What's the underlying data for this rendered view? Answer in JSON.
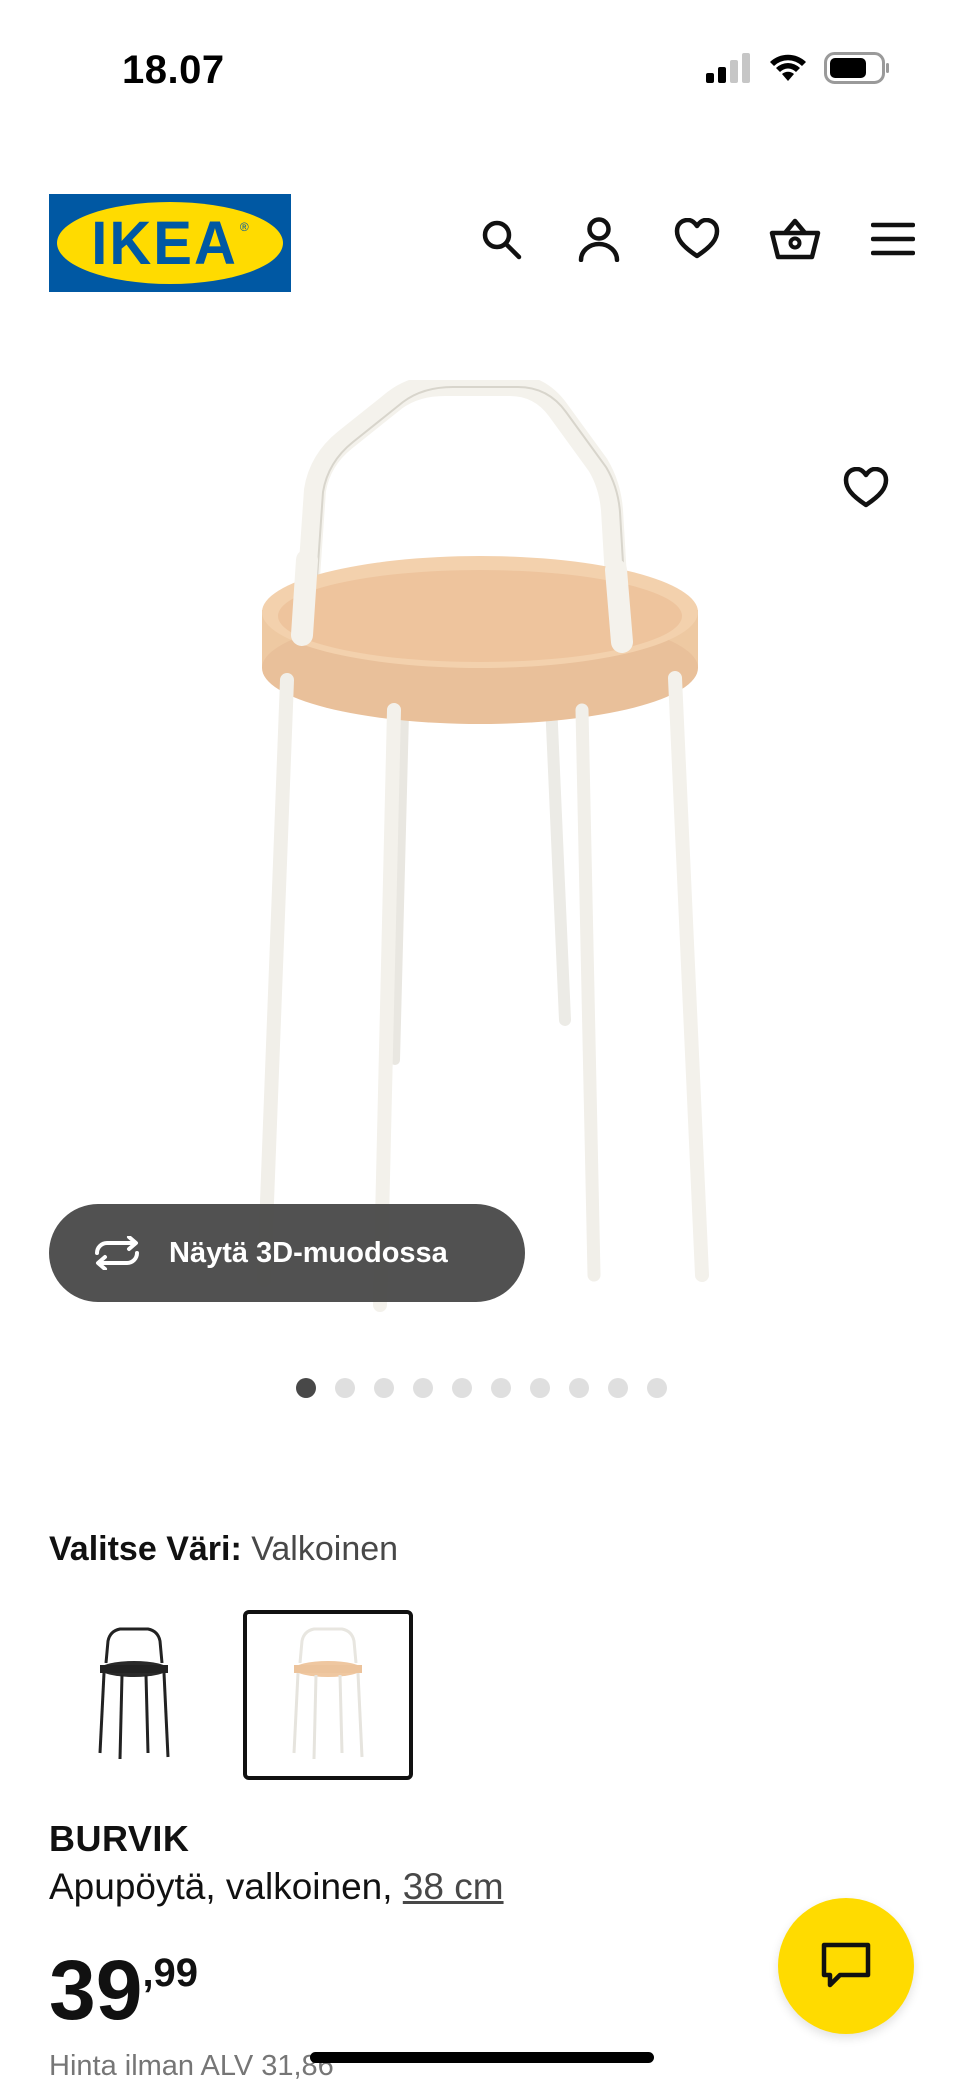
{
  "status_bar": {
    "time": "18.07",
    "icons": [
      "cellular-signal-icon",
      "wifi-icon",
      "battery-icon"
    ]
  },
  "header": {
    "logo_text": "IKEA",
    "nav_icons": [
      "search-icon",
      "user-icon",
      "heart-icon",
      "basket-icon",
      "menu-icon"
    ]
  },
  "gallery": {
    "view_3d_label": "Näytä 3D-muodossa",
    "dot_count": 10,
    "active_dot": 1
  },
  "color": {
    "label": "Valitse Väri:",
    "value": "Valkoinen",
    "swatches": [
      "black",
      "white"
    ],
    "selected_swatch": "white"
  },
  "product": {
    "name": "BURVIK",
    "description_prefix": "Apupöytä, valkoinen,",
    "size_link": "38 cm",
    "price_main": "39",
    "price_decimals": ",99",
    "price_vat": "Hinta ilman ALV 31,86"
  },
  "colors": {
    "ikea_blue": "#0058a3",
    "ikea_yellow": "#ffdb00",
    "table_wood": "#f0c9a0",
    "frame_white": "#f4f2ec"
  }
}
